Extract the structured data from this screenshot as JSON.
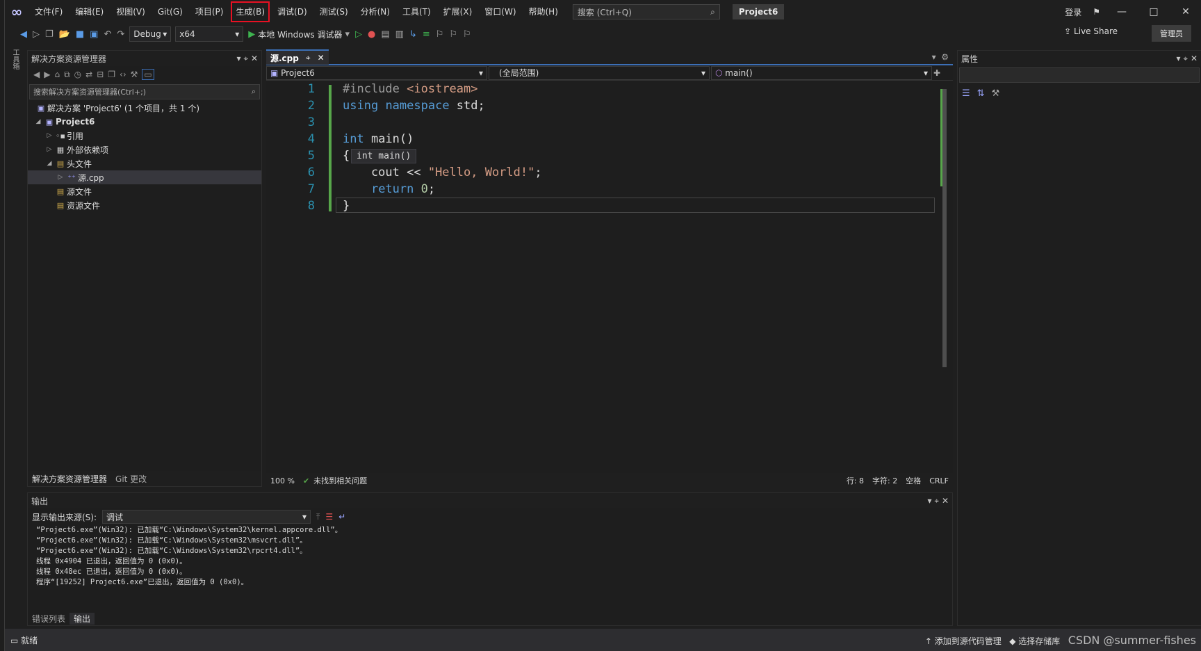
{
  "menu": [
    "文件(F)",
    "编辑(E)",
    "视图(V)",
    "Git(G)",
    "项目(P)",
    "生成(B)",
    "调试(D)",
    "测试(S)",
    "分析(N)",
    "工具(T)",
    "扩展(X)",
    "窗口(W)",
    "帮助(H)"
  ],
  "highlighted_menu": "生成(B)",
  "search_placeholder": "搜索 (Ctrl+Q)",
  "project_title": "Project6",
  "login": "登录",
  "toolbar": {
    "config": "Debug",
    "platform": "x64",
    "run_label": "本地 Windows 调试器",
    "live_share": "Live Share",
    "admin": "管理员"
  },
  "left_strip": "工具箱",
  "solution_explorer": {
    "title": "解决方案资源管理器",
    "search": "搜索解决方案资源管理器(Ctrl+;)",
    "tree": [
      {
        "label": "解决方案 'Project6' (1 个项目，共 1 个)"
      },
      {
        "label": "Project6"
      },
      {
        "label": "引用"
      },
      {
        "label": "外部依赖项"
      },
      {
        "label": "头文件"
      },
      {
        "label": "源.cpp"
      },
      {
        "label": "源文件"
      },
      {
        "label": "资源文件"
      }
    ],
    "tab_active": "解决方案资源管理器",
    "tab_other": "Git 更改"
  },
  "editor": {
    "tab": "源.cpp",
    "nav_project": "Project6",
    "nav_scope": "(全局范围)",
    "nav_func": "main()",
    "lines": [
      "1",
      "2",
      "3",
      "4",
      "5",
      "6",
      "7",
      "8"
    ],
    "tooltip": "int main()",
    "zoom": "100 %",
    "issues": "未找到相关问题",
    "row": "行: 8",
    "col": "字符: 2",
    "space": "空格",
    "eol": "CRLF"
  },
  "properties": {
    "title": "属性"
  },
  "output": {
    "title": "输出",
    "source_label": "显示输出来源(S):",
    "source": "调试",
    "lines": [
      "“Project6.exe”(Win32): 已加载“C:\\Windows\\System32\\kernel.appcore.dll”。",
      "“Project6.exe”(Win32): 已加载“C:\\Windows\\System32\\msvcrt.dll”。",
      "“Project6.exe”(Win32): 已加载“C:\\Windows\\System32\\rpcrt4.dll”。",
      "线程 0x4904 已退出，返回值为 0 (0x0)。",
      "线程 0x48ec 已退出，返回值为 0 (0x0)。",
      "程序“[19252] Project6.exe”已退出，返回值为 0 (0x0)。"
    ],
    "tab_errors": "错误列表",
    "tab_output": "输出"
  },
  "status": {
    "ready": "就绪",
    "add_source": "添加到源代码管理",
    "select_repo": "选择存储库",
    "watermark": "CSDN @summer-fishes"
  }
}
